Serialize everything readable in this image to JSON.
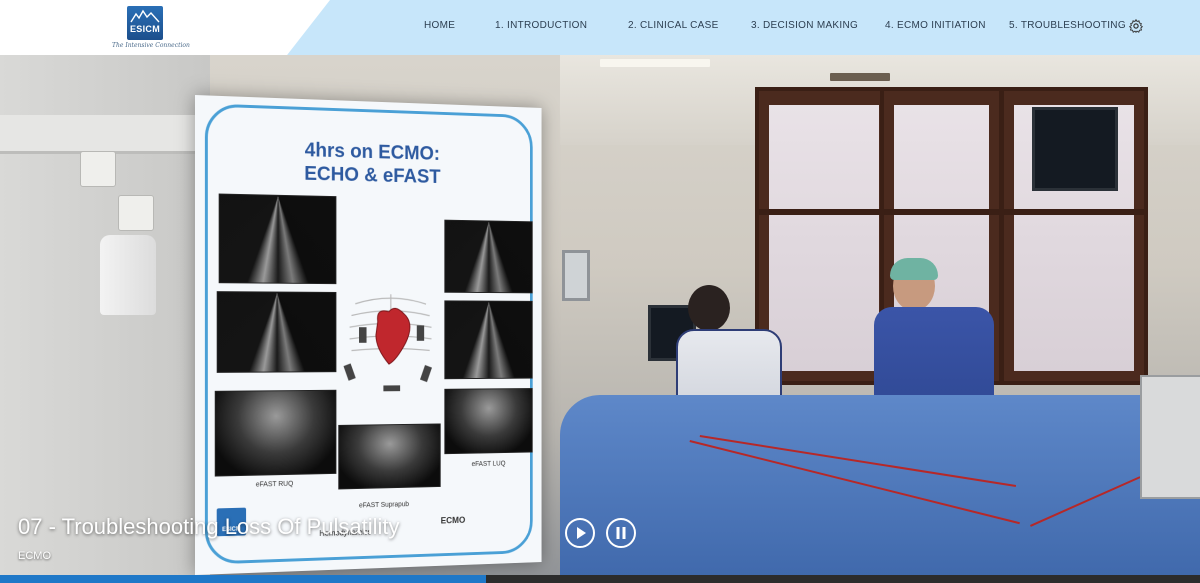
{
  "header": {
    "logo_text": "ESICM",
    "tagline": "The Intensive Connection",
    "nav": [
      {
        "label": "HOME"
      },
      {
        "label": "1. INTRODUCTION"
      },
      {
        "label": "2. CLINICAL CASE"
      },
      {
        "label": "3. DECISION MAKING"
      },
      {
        "label": "4. ECMO INITIATION"
      },
      {
        "label": "5. TROUBLESHOOTING"
      }
    ],
    "settings_icon": "gear-icon"
  },
  "slide": {
    "title_line1": "4hrs on ECMO:",
    "title_line2": "ECHO & eFAST",
    "captions": {
      "ruq": "eFAST RUQ",
      "luq": "eFAST LUQ",
      "suprapub": "eFAST Suprapub"
    },
    "footer_left": "Hemodynamics",
    "footer_right": "ECMO",
    "logo_text": "ESICM"
  },
  "video": {
    "title": "07 - Troubleshooting Loss Of Pulsatility",
    "subtitle": "ECMO",
    "play_icon": "play-icon",
    "pause_icon": "pause-icon",
    "progress": 0.405
  },
  "colors": {
    "header_bg": "#c7e6fa",
    "accent": "#1f78c8",
    "slide_frame": "#4aa0d6",
    "slide_title": "#2e5aa0"
  }
}
